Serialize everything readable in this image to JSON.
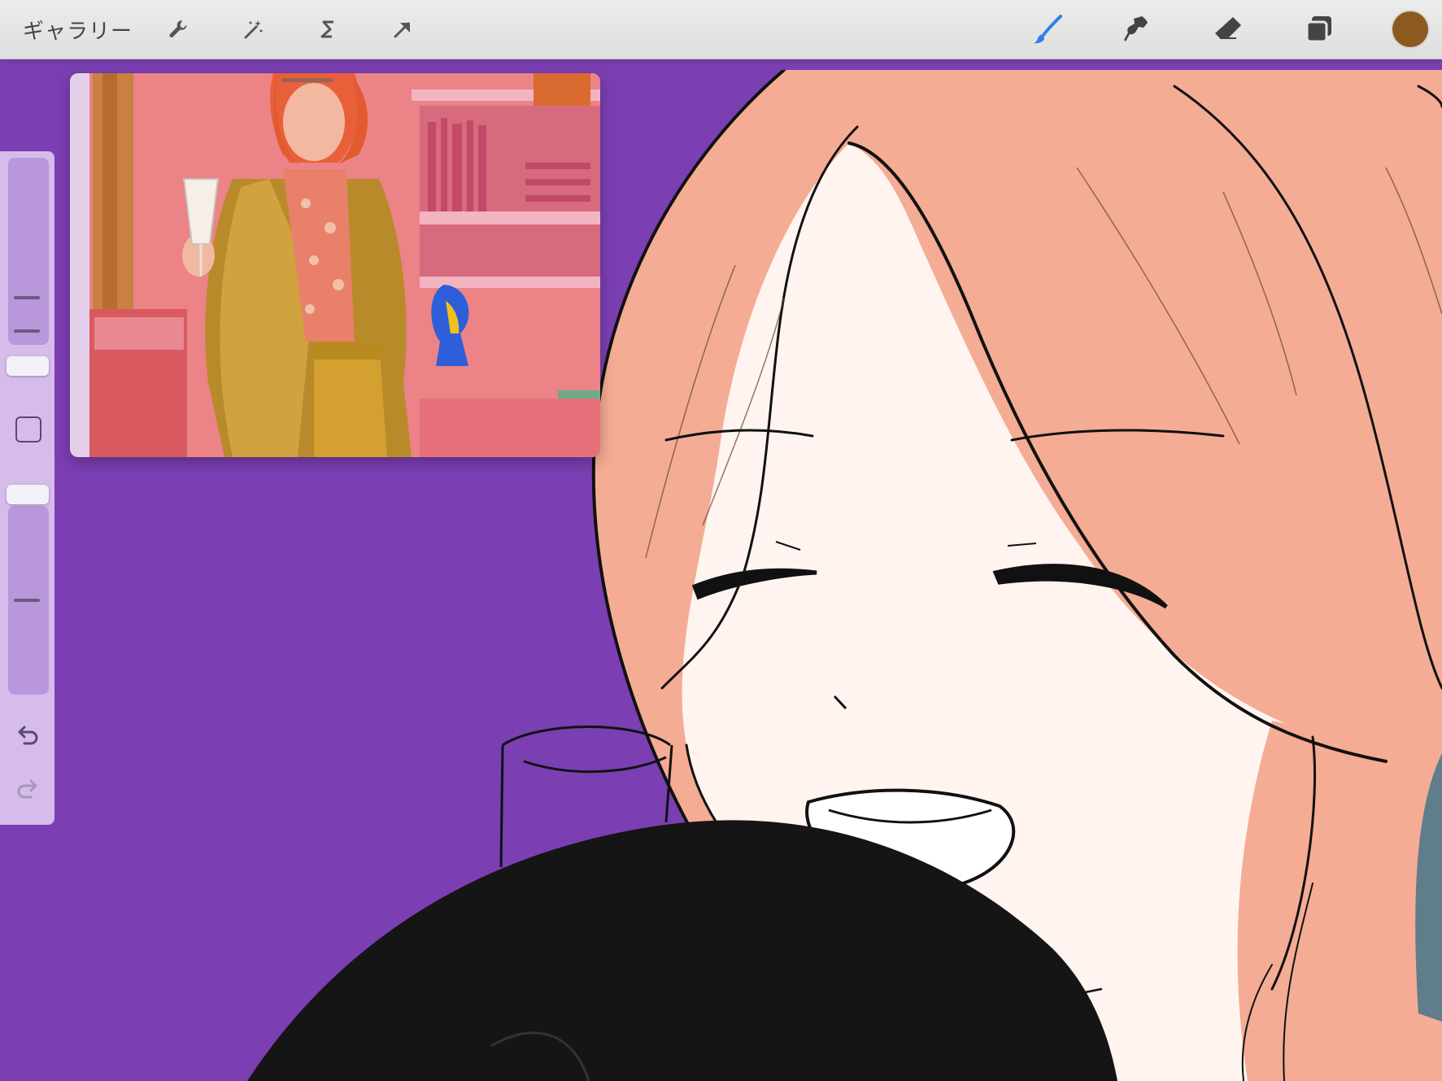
{
  "toolbar": {
    "gallery_label": "ギャラリー",
    "left_tools": [
      {
        "name": "actions-icon"
      },
      {
        "name": "adjustments-icon"
      },
      {
        "name": "selection-icon"
      },
      {
        "name": "transform-icon"
      }
    ],
    "right_tools": [
      {
        "name": "brush-icon",
        "active": true,
        "color": "#2f7fe8"
      },
      {
        "name": "smudge-icon"
      },
      {
        "name": "eraser-icon"
      },
      {
        "name": "layers-icon"
      }
    ],
    "current_color": "#8c5a1e"
  },
  "sidebar": {
    "brush_size": 0.73,
    "opacity": 0.78
  },
  "canvas": {
    "background_color": "#7b3fb3",
    "hair_color": "#f4ac95",
    "skin_color": "#fff4f0"
  },
  "reference": {
    "visible": true
  }
}
